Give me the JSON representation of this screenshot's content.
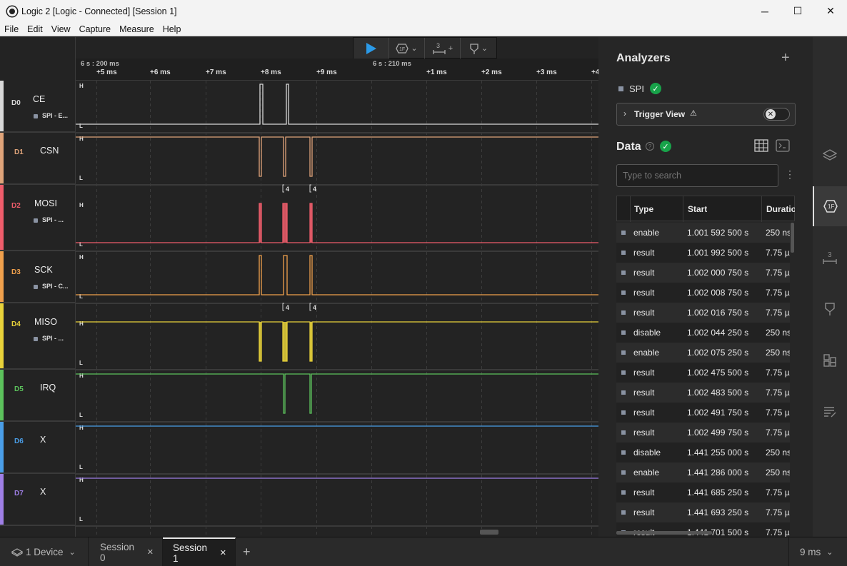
{
  "window": {
    "title": "Logic 2 [Logic - Connected] [Session 1]",
    "minimize": "─",
    "maximize": "☐",
    "close": "✕"
  },
  "menu": [
    "File",
    "Edit",
    "View",
    "Capture",
    "Measure",
    "Help"
  ],
  "toolbar": {
    "trigger_count": "3",
    "plus": "+"
  },
  "ruler": {
    "left_marker": "6 s : 200 ms",
    "mid_marker": "6 s : 210 ms",
    "ticks": [
      "+5 ms",
      "+6 ms",
      "+7 ms",
      "+8 ms",
      "+9 ms",
      "+1 ms",
      "+2 ms",
      "+3 ms",
      "+4"
    ]
  },
  "channels": [
    {
      "num": "D0",
      "name": "CE",
      "sub": "SPI - E...",
      "color": "#d8d8d8"
    },
    {
      "num": "D1",
      "name": "CSN",
      "sub": "",
      "color": "#e0a47a"
    },
    {
      "num": "D2",
      "name": "MOSI",
      "sub": "SPI - ...",
      "color": "#ef5d6b"
    },
    {
      "num": "D3",
      "name": "SCK",
      "sub": "SPI - C...",
      "color": "#f0a04c"
    },
    {
      "num": "D4",
      "name": "MISO",
      "sub": "SPI - ...",
      "color": "#e8d23a"
    },
    {
      "num": "D5",
      "name": "IRQ",
      "sub": "",
      "color": "#5cc25c"
    },
    {
      "num": "D6",
      "name": "X",
      "sub": "",
      "color": "#4a9ee8"
    },
    {
      "num": "D7",
      "name": "X",
      "sub": "",
      "color": "#9f7fe6"
    }
  ],
  "levels": {
    "high": "H",
    "low": "L"
  },
  "burst_label": "4",
  "analyzers": {
    "title": "Analyzers",
    "add": "+",
    "items": [
      {
        "name": "SPI",
        "status": "ok"
      }
    ],
    "trigger_view": "Trigger View"
  },
  "data_panel": {
    "title": "Data",
    "search_placeholder": "Type to search",
    "columns": [
      "Type",
      "Start",
      "Duration"
    ],
    "rows": [
      {
        "type": "enable",
        "start": "1.001 592 500 s",
        "duration": "250 ns"
      },
      {
        "type": "result",
        "start": "1.001 992 500 s",
        "duration": "7.75 µ"
      },
      {
        "type": "result",
        "start": "1.002 000 750 s",
        "duration": "7.75 µ"
      },
      {
        "type": "result",
        "start": "1.002 008 750 s",
        "duration": "7.75 µ"
      },
      {
        "type": "result",
        "start": "1.002 016 750 s",
        "duration": "7.75 µ"
      },
      {
        "type": "disable",
        "start": "1.002 044 250 s",
        "duration": "250 ns"
      },
      {
        "type": "enable",
        "start": "1.002 075 250 s",
        "duration": "250 ns"
      },
      {
        "type": "result",
        "start": "1.002 475 500 s",
        "duration": "7.75 µ"
      },
      {
        "type": "result",
        "start": "1.002 483 500 s",
        "duration": "7.75 µ"
      },
      {
        "type": "result",
        "start": "1.002 491 750 s",
        "duration": "7.75 µ"
      },
      {
        "type": "result",
        "start": "1.002 499 750 s",
        "duration": "7.75 µ"
      },
      {
        "type": "disable",
        "start": "1.441 255 000 s",
        "duration": "250 ns"
      },
      {
        "type": "enable",
        "start": "1.441 286 000 s",
        "duration": "250 ns"
      },
      {
        "type": "result",
        "start": "1.441 685 250 s",
        "duration": "7.75 µ"
      },
      {
        "type": "result",
        "start": "1.441 693 250 s",
        "duration": "7.75 µ"
      },
      {
        "type": "result",
        "start": "1.441 701 500 s",
        "duration": "7.75 µ"
      }
    ]
  },
  "bottom": {
    "device": "1 Device",
    "tabs": [
      "Session 0",
      "Session 1"
    ],
    "active_tab": 1,
    "add": "+",
    "zoom": "9 ms"
  }
}
